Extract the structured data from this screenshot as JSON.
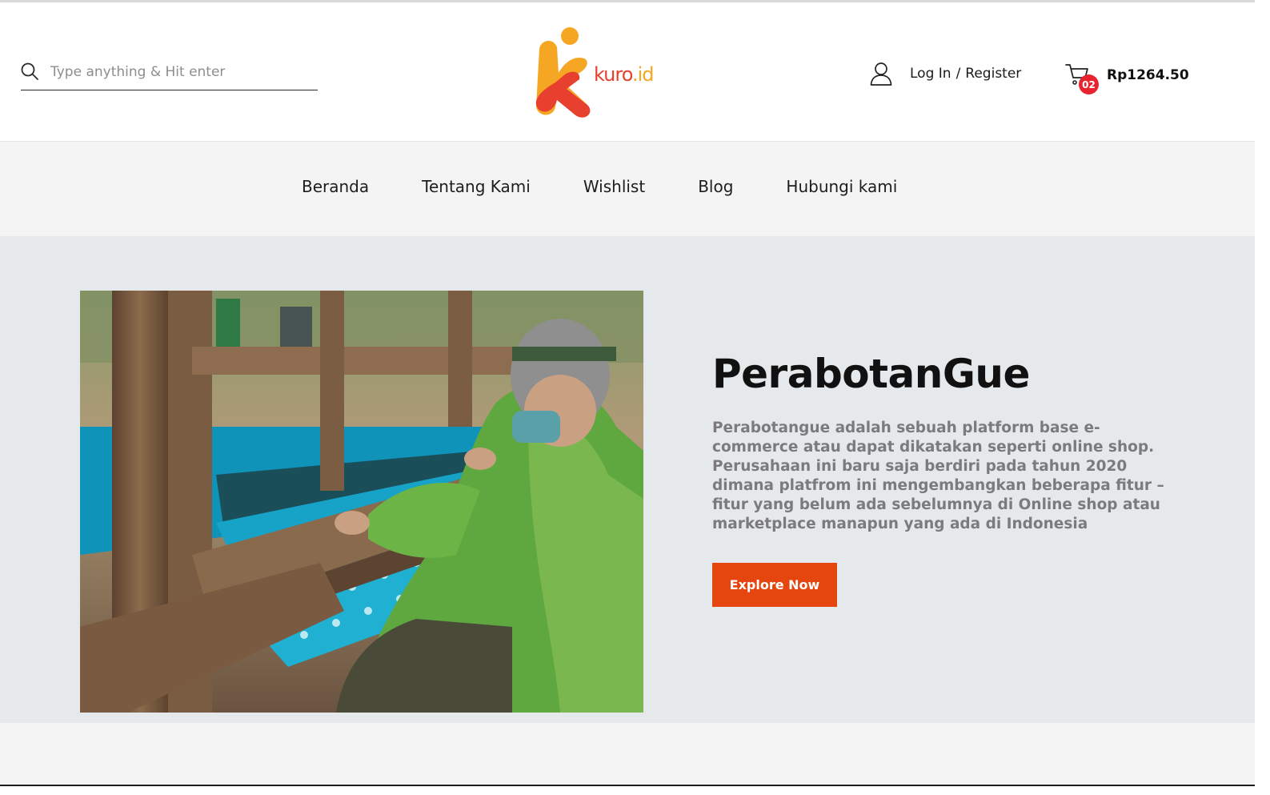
{
  "header": {
    "search": {
      "placeholder": "Type anything & Hit enter",
      "value": ""
    },
    "logo": {
      "name": "kuro",
      "tld": ".id"
    },
    "account": {
      "login_label": "Log In",
      "separator": "/",
      "register_label": "Register"
    },
    "cart": {
      "count": "02",
      "total": "Rp1264.50"
    }
  },
  "nav": {
    "items": [
      {
        "label": "Beranda"
      },
      {
        "label": "Tentang Kami"
      },
      {
        "label": "Wishlist"
      },
      {
        "label": "Blog"
      },
      {
        "label": "Hubungi kami"
      }
    ]
  },
  "hero": {
    "title": "PerabotanGue",
    "description": "Perabotangue adalah sebuah platform base e-commerce atau dapat dikatakan seperti online shop. Perusahaan ini baru saja berdiri pada tahun 2020 dimana platfrom ini mengembangkan beberapa fitur – fitur yang belum ada sebelumnya di Online shop atau marketplace manapun yang ada di Indonesia",
    "button_label": "Explore Now"
  },
  "colors": {
    "accent": "#e5450f",
    "badge": "#e8232f",
    "logo_orange": "#f5a623",
    "logo_red": "#e8402e",
    "hero_bg": "#e6e9ec",
    "nav_bg": "#f4f4f4"
  },
  "icons": {
    "search": "search-icon",
    "account": "user-icon",
    "cart": "cart-icon"
  }
}
